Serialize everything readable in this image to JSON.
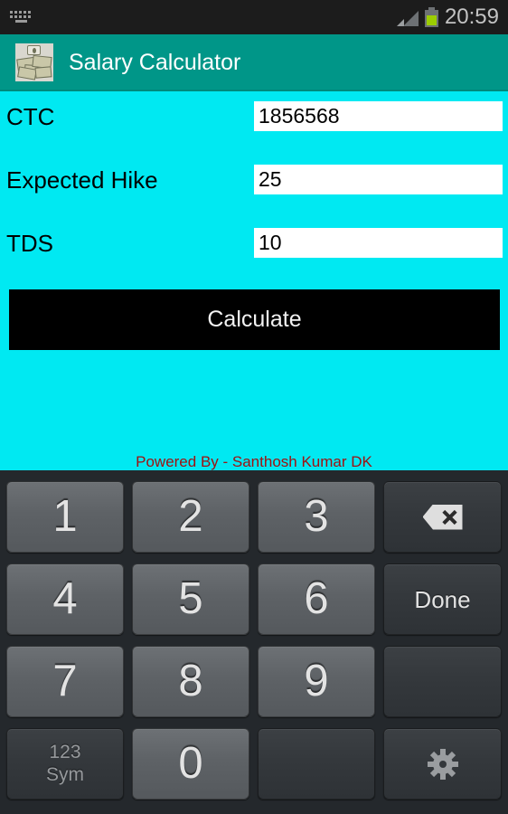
{
  "statusbar": {
    "keyboard_icon": "keyboard-icon",
    "signal_icon": "signal-bars-icon",
    "battery_icon": "battery-icon",
    "time": "20:59"
  },
  "appbar": {
    "icon": "money-stack-icon",
    "title": "Salary Calculator",
    "color": "#009688"
  },
  "form": {
    "background_color": "#00e9f2",
    "fields": [
      {
        "label": "CTC",
        "value": "1856568",
        "placeholder": ""
      },
      {
        "label": "Expected Hike",
        "value": "25",
        "placeholder": ""
      },
      {
        "label": "TDS",
        "value": "10",
        "placeholder": ""
      }
    ],
    "calculate_label": "Calculate",
    "calculate_color": "#000000",
    "footer_credit": "Powered By - Santhosh Kumar DK",
    "footer_color": "#a01111"
  },
  "keyboard": {
    "background_color": "#24282c",
    "rows": [
      [
        {
          "label": "1",
          "type": "num",
          "name": "key-1"
        },
        {
          "label": "2",
          "type": "num",
          "name": "key-2"
        },
        {
          "label": "3",
          "type": "num",
          "name": "key-3"
        },
        {
          "label": "",
          "type": "fn",
          "name": "key-backspace",
          "icon": "backspace-icon"
        }
      ],
      [
        {
          "label": "4",
          "type": "num",
          "name": "key-4"
        },
        {
          "label": "5",
          "type": "num",
          "name": "key-5"
        },
        {
          "label": "6",
          "type": "num",
          "name": "key-6"
        },
        {
          "label": "Done",
          "type": "fn",
          "name": "key-done"
        }
      ],
      [
        {
          "label": "7",
          "type": "num",
          "name": "key-7"
        },
        {
          "label": "8",
          "type": "num",
          "name": "key-8"
        },
        {
          "label": "9",
          "type": "num",
          "name": "key-9"
        },
        {
          "label": "",
          "type": "blank",
          "name": "key-blank-1"
        }
      ],
      [
        {
          "label": "123\nSym",
          "label_line1": "123",
          "label_line2": "Sym",
          "type": "fn",
          "name": "key-sym"
        },
        {
          "label": "0",
          "type": "num",
          "name": "key-0"
        },
        {
          "label": "",
          "type": "blank",
          "name": "key-blank-2"
        },
        {
          "label": "",
          "type": "fn",
          "name": "key-settings",
          "icon": "gear-icon"
        }
      ]
    ]
  }
}
